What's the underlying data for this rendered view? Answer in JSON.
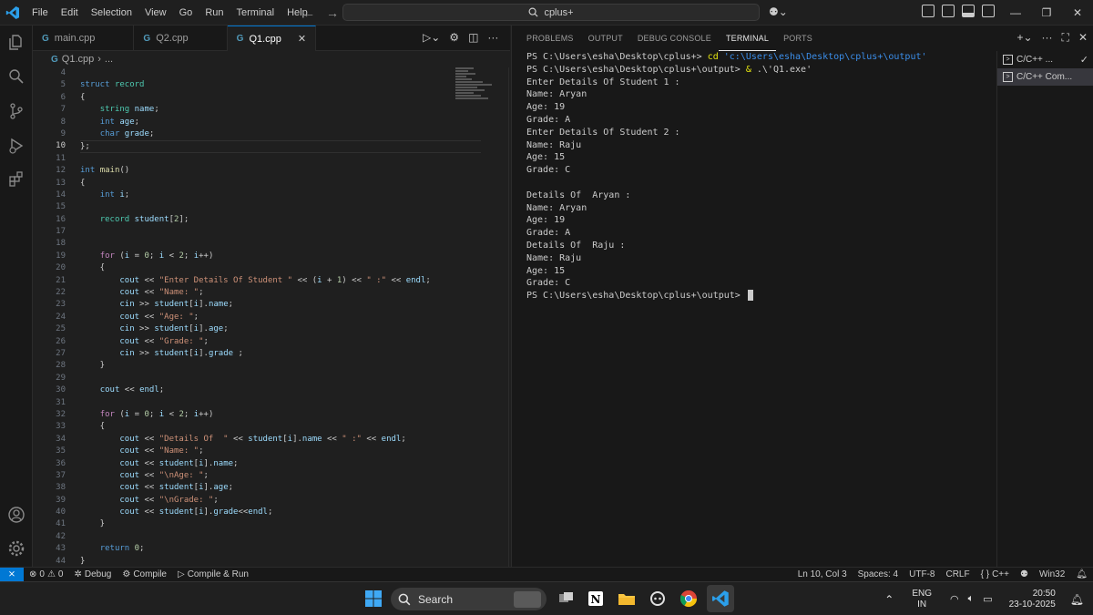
{
  "menu": [
    "File",
    "Edit",
    "Selection",
    "View",
    "Go",
    "Run",
    "Terminal",
    "Help"
  ],
  "search": {
    "label": "cplus+"
  },
  "editor": {
    "tabs": [
      {
        "label": "main.cpp",
        "active": false
      },
      {
        "label": "Q2.cpp",
        "active": false
      },
      {
        "label": "Q1.cpp",
        "active": true
      }
    ],
    "breadcrumb": [
      "Q1.cpp",
      "..."
    ],
    "current_line": 10,
    "code_lines": [
      {
        "n": 4,
        "t": ""
      },
      {
        "n": 5,
        "t": "struct record"
      },
      {
        "n": 6,
        "t": "{"
      },
      {
        "n": 7,
        "t": "    string name;"
      },
      {
        "n": 8,
        "t": "    int age;"
      },
      {
        "n": 9,
        "t": "    char grade;"
      },
      {
        "n": 10,
        "t": "};"
      },
      {
        "n": 11,
        "t": ""
      },
      {
        "n": 12,
        "t": "int main()"
      },
      {
        "n": 13,
        "t": "{"
      },
      {
        "n": 14,
        "t": "    int i;"
      },
      {
        "n": 15,
        "t": ""
      },
      {
        "n": 16,
        "t": "    record student[2];"
      },
      {
        "n": 17,
        "t": ""
      },
      {
        "n": 18,
        "t": ""
      },
      {
        "n": 19,
        "t": "    for (i = 0; i < 2; i++)"
      },
      {
        "n": 20,
        "t": "    {"
      },
      {
        "n": 21,
        "t": "        cout << \"Enter Details Of Student \" << (i + 1) << \" :\" << endl;"
      },
      {
        "n": 22,
        "t": "        cout << \"Name: \";"
      },
      {
        "n": 23,
        "t": "        cin >> student[i].name;"
      },
      {
        "n": 24,
        "t": "        cout << \"Age: \";"
      },
      {
        "n": 25,
        "t": "        cin >> student[i].age;"
      },
      {
        "n": 26,
        "t": "        cout << \"Grade: \";"
      },
      {
        "n": 27,
        "t": "        cin >> student[i].grade ;"
      },
      {
        "n": 28,
        "t": "    }"
      },
      {
        "n": 29,
        "t": ""
      },
      {
        "n": 30,
        "t": "    cout << endl;"
      },
      {
        "n": 31,
        "t": ""
      },
      {
        "n": 32,
        "t": "    for (i = 0; i < 2; i++)"
      },
      {
        "n": 33,
        "t": "    {"
      },
      {
        "n": 34,
        "t": "        cout << \"Details Of  \" << student[i].name << \" :\" << endl;"
      },
      {
        "n": 35,
        "t": "        cout << \"Name: \";"
      },
      {
        "n": 36,
        "t": "        cout << student[i].name;"
      },
      {
        "n": 37,
        "t": "        cout << \"\\nAge: \";"
      },
      {
        "n": 38,
        "t": "        cout << student[i].age;"
      },
      {
        "n": 39,
        "t": "        cout << \"\\nGrade: \";"
      },
      {
        "n": 40,
        "t": "        cout << student[i].grade<<endl;"
      },
      {
        "n": 41,
        "t": "    }"
      },
      {
        "n": 42,
        "t": ""
      },
      {
        "n": 43,
        "t": "    return 0;"
      },
      {
        "n": 44,
        "t": "}"
      }
    ]
  },
  "panel": {
    "tabs": [
      "PROBLEMS",
      "OUTPUT",
      "DEBUG CONSOLE",
      "TERMINAL",
      "PORTS"
    ],
    "active_tab": "TERMINAL",
    "terminal_lines": [
      {
        "prompt": "PS C:\\Users\\esha\\Desktop\\cplus+> ",
        "cmd": "cd",
        "arg": " 'c:\\Users\\esha\\Desktop\\cplus+\\output'"
      },
      {
        "prompt": "PS C:\\Users\\esha\\Desktop\\cplus+\\output> ",
        "cmd": "&",
        "arg": " .\\'Q1.exe'"
      },
      {
        "text": "Enter Details Of Student 1 :"
      },
      {
        "text": "Name: Aryan"
      },
      {
        "text": "Age: 19"
      },
      {
        "text": "Grade: A"
      },
      {
        "text": "Enter Details Of Student 2 :"
      },
      {
        "text": "Name: Raju"
      },
      {
        "text": "Age: 15"
      },
      {
        "text": "Grade: C"
      },
      {
        "text": ""
      },
      {
        "text": "Details Of  Aryan :"
      },
      {
        "text": "Name: Aryan"
      },
      {
        "text": "Age: 19"
      },
      {
        "text": "Grade: A"
      },
      {
        "text": "Details Of  Raju :"
      },
      {
        "text": "Name: Raju"
      },
      {
        "text": "Age: 15"
      },
      {
        "text": "Grade: C"
      },
      {
        "prompt": "PS C:\\Users\\esha\\Desktop\\cplus+\\output> ",
        "cursor": true
      }
    ],
    "terminal_list": [
      {
        "label": "C/C++ ...",
        "selected": false,
        "check": true
      },
      {
        "label": "C/C++ Com...",
        "selected": true,
        "check": false
      }
    ]
  },
  "statusbar": {
    "errors": "0",
    "warnings": "0",
    "debug": "Debug",
    "compile": "Compile",
    "compile_run": "Compile & Run",
    "position": "Ln 10, Col 3",
    "spaces": "Spaces: 4",
    "encoding": "UTF-8",
    "eol": "CRLF",
    "language": "C++",
    "platform": "Win32"
  },
  "taskbar": {
    "search_label": "Search",
    "lang_line1": "ENG",
    "lang_line2": "IN",
    "time": "20:50",
    "date": "23-10-2025"
  },
  "colors": {
    "accent": "#0078d4",
    "keyword": "#569cd6",
    "control": "#c586c0",
    "type": "#4ec9b0",
    "string": "#ce9178",
    "number": "#b5cea8",
    "variable": "#9cdcfe",
    "function": "#dcdcaa"
  }
}
